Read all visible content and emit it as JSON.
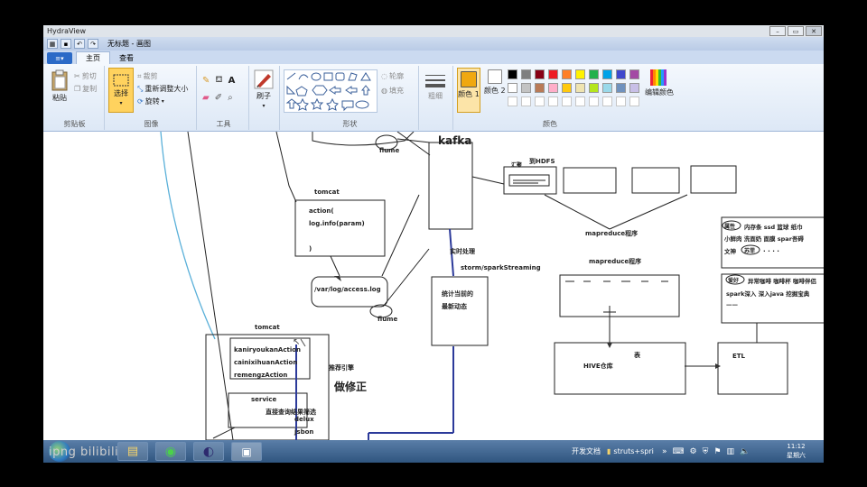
{
  "window": {
    "title": "HydraView"
  },
  "paint": {
    "doc_title": "无标题 - 画图",
    "file_button": "≡▾",
    "tabs": [
      "主页",
      "查看"
    ]
  },
  "ribbon": {
    "clipboard": {
      "paste": "粘贴",
      "cut": "剪切",
      "copy": "复制",
      "group": "剪贴板"
    },
    "image": {
      "select": "选择",
      "crop": "裁剪",
      "resize": "重新调整大小",
      "rotate": "旋转",
      "group": "图像"
    },
    "tools": {
      "group": "工具"
    },
    "brush": {
      "label": "刷子"
    },
    "shapes": {
      "outline": "轮廓",
      "fill": "填充",
      "group": "形状"
    },
    "size": {
      "label": "粗细"
    },
    "colors": {
      "color1": "颜色 1",
      "color2": "颜色 2",
      "edit": "编辑颜色",
      "group": "颜色",
      "palette_row1": [
        "#000000",
        "#7f7f7f",
        "#880015",
        "#ed1c24",
        "#ff7f27",
        "#fff200",
        "#22b14c",
        "#00a2e8",
        "#3f48cc",
        "#a349a4"
      ],
      "palette_row2": [
        "#ffffff",
        "#c3c3c3",
        "#b97a57",
        "#ffaec9",
        "#ffc90e",
        "#efe4b0",
        "#b5e61d",
        "#99d9ea",
        "#7092be",
        "#c8bfe7"
      ],
      "active_color": "#f0a810"
    }
  },
  "diagram": {
    "kafka": "kafka",
    "flume_top": "flume",
    "flume_mid": "flume",
    "tomcat_top": "tomcat",
    "action_lines": [
      "action(",
      "log.info(param)",
      ")"
    ],
    "access_log": "/var/log/access.log",
    "huihui": "汇聚",
    "hdfs": "到HDFS",
    "realtime": "实时处理",
    "storm": "storm/sparkStreaming",
    "stats_lines": [
      "统计当前的",
      "最新动态"
    ],
    "mapreduce1": "mapreduce程序",
    "mapreduce2": "mapreduce程序",
    "hive_table": "表",
    "hive": "HIVE仓库",
    "etl": "ETL",
    "tomcat_bottom": "tomcat",
    "actions": [
      "kaniryoukanAction",
      "cainixihuanAction",
      "remengzAction"
    ],
    "engine": "推荐引擎",
    "fix": "做修正",
    "service": "service",
    "direct": "直接查询结果筛选",
    "delux": "delux",
    "jsbon": "jsbon",
    "tags1": "内存条  ssd  篮球  纸巾",
    "tags2": "小鲜肉  洗面奶  面膜  spar吾碍",
    "tags3": "文神",
    "tags3_circle": "苏菲",
    "tags3_dots": ". . . .",
    "tags1_circle": "属性",
    "tags4": "异常咖啡  咖啡杯  咖啡伴侣",
    "tags4_circle": "爱好",
    "tags5": "spark深入  深入java  挖掘宝典",
    "tags6": "——"
  },
  "taskbar": {
    "tray_items": [
      "开发文档",
      "struts+spri"
    ],
    "time": "11:12",
    "day": "星期六"
  },
  "watermark": "ipng bilibili"
}
